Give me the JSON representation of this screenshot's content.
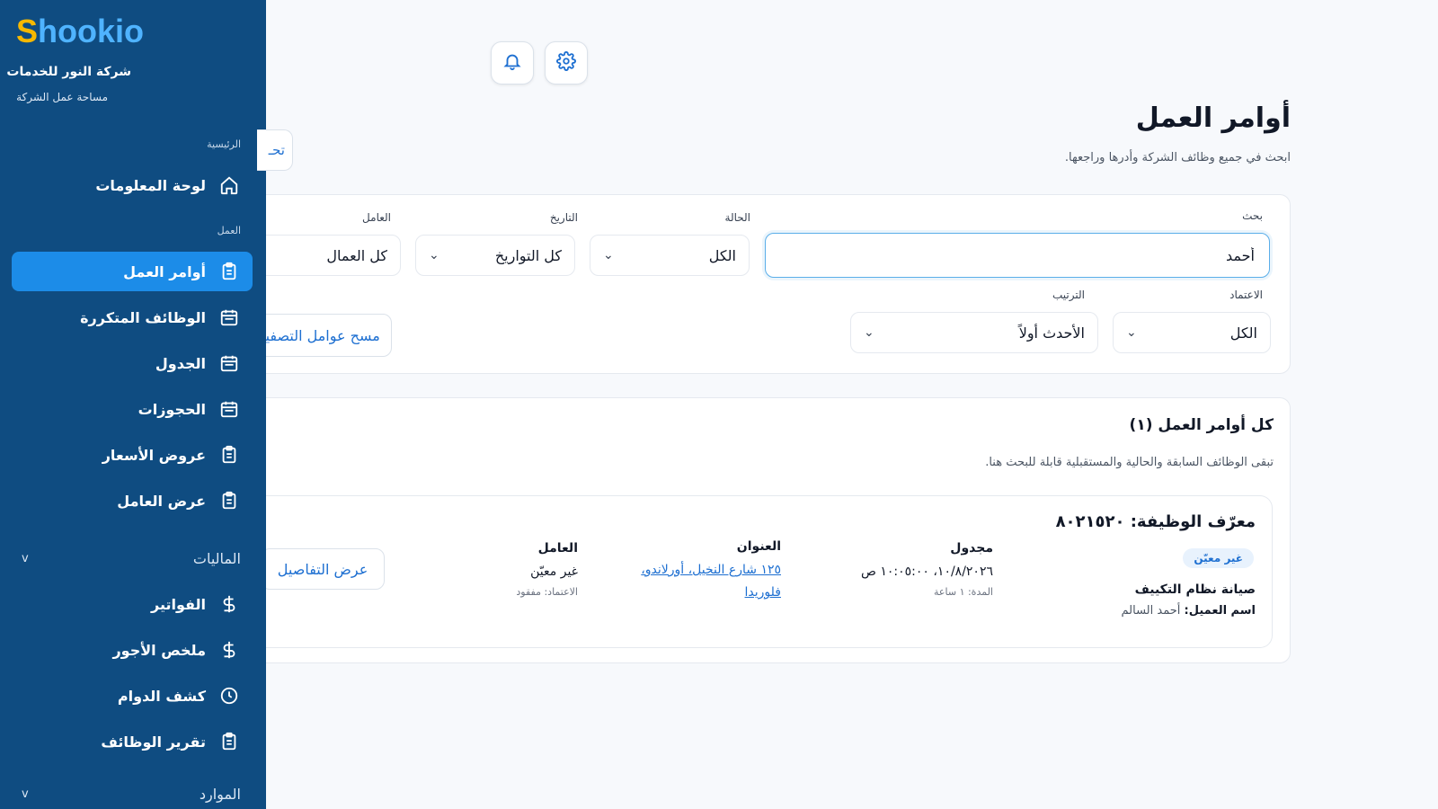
{
  "brand": {
    "logo_first": "S",
    "logo_rest": "hookio",
    "company_name": "شركة النور للخدمات",
    "company_subtitle": "مساحة عمل الشركة"
  },
  "colors": {
    "sidebar_bg": "#0f4c81",
    "active_item": "#1c8ce8",
    "logo_yellow": "#f6b800",
    "logo_blue": "#4fb3ff",
    "accent": "#1d6fd1"
  },
  "sidebar": {
    "section_main": "الرئيسية",
    "dashboard": {
      "label": "لوحة المعلومات",
      "icon": "home-icon"
    },
    "section_work": "العمل",
    "work_items": [
      {
        "label": "أوامر العمل",
        "icon": "clipboard-icon",
        "active": true
      },
      {
        "label": "الوظائف المتكررة",
        "icon": "calendar-icon"
      },
      {
        "label": "الجدول",
        "icon": "calendar-icon"
      },
      {
        "label": "الحجوزات",
        "icon": "calendar-icon"
      },
      {
        "label": "عروض الأسعار",
        "icon": "clipboard-icon"
      },
      {
        "label": "عرض العامل",
        "icon": "clipboard-icon"
      }
    ],
    "finance_group": {
      "label": "الماليات",
      "chevron": "v"
    },
    "finance_items": [
      {
        "label": "الفواتير",
        "icon": "dollar-icon"
      },
      {
        "label": "ملخص الأجور",
        "icon": "dollar-icon"
      },
      {
        "label": "كشف الدوام",
        "icon": "clock-icon"
      },
      {
        "label": "تقرير الوظائف",
        "icon": "clipboard-icon"
      }
    ],
    "resources_group": {
      "label": "الموارد",
      "chevron": "v"
    }
  },
  "topbar": {
    "notifications_icon": "bell-icon",
    "settings_icon": "gear-icon"
  },
  "header": {
    "title": "أوامر العمل",
    "subtitle": "ابحث في جميع وظائف الشركة وأدرها وراجعها.",
    "cut_button_text": "تحـ"
  },
  "filters": {
    "search_label": "بحث",
    "search_value": "أحمد",
    "status_label": "الحالة",
    "status_value": "الكل",
    "date_label": "التاريخ",
    "date_value": "كل التواريخ",
    "worker_label": "العامل",
    "worker_value": "كل العمال",
    "approval_label": "الاعتماد",
    "approval_value": "الكل",
    "sort_label": "الترتيب",
    "sort_value": "الأحدث أولاً",
    "clear_button": "مسح عوامل التصفية",
    "chevron": "⌄"
  },
  "results": {
    "title": "كل أوامر العمل (١)",
    "subtitle": "تبقى الوظائف السابقة والحالية والمستقبلية قابلة للبحث هنا.",
    "jobs": [
      {
        "job_id": "معرّف الوظيفة: ٨٠٢١٥٢٠",
        "badge": "غير معيّن",
        "title": "صيانة نظام التكييف",
        "client_label": "اسم العميل:",
        "client_name": "أحمد السالم",
        "scheduled_label": "مجدول",
        "scheduled_value": "١٠/٨/٢٠٢٦، ١٠:٠٥:٠٠ ص",
        "duration": "المدة: ١ ساعة",
        "address_label": "العنوان",
        "address_value": "١٢٥ شارع النخيل، أورلاندو، فلوريدا",
        "worker_label": "العامل",
        "worker_value": "غير معيّن",
        "approval_status": "الاعتماد: مفقود",
        "details_button": "عرض التفاصيل"
      }
    ]
  }
}
